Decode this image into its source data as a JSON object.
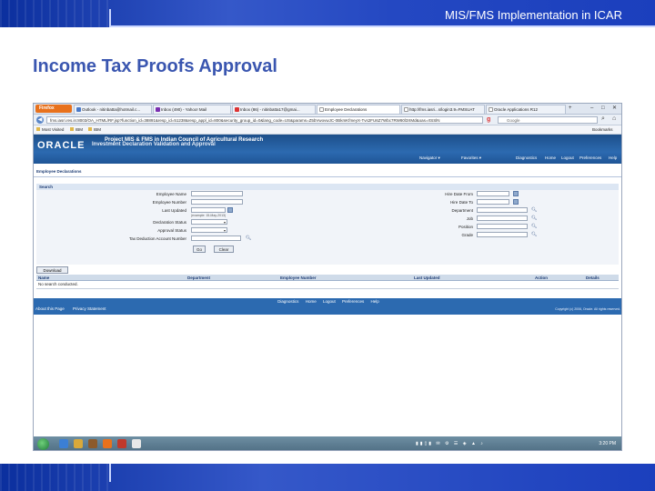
{
  "slide": {
    "header_title": "MIS/FMS Implementation in ICAR",
    "title": "Income Tax Proofs Approval"
  },
  "browser": {
    "menu_button": "Firefox",
    "tabs": [
      {
        "label": "Outlook - nitinbatta@hotmail.c..."
      },
      {
        "label": "Inbox (490) - Yahoo! Mail"
      },
      {
        "label": "Inbox (86) - nitinbatta17@gmai..."
      },
      {
        "label": "Employee Declarations"
      },
      {
        "label": "http://fms.iasri...s/login3.9=FMSUAT"
      },
      {
        "label": "Oracle Applications R12"
      }
    ],
    "url": "fms.iasri.res.in:8003/OA_HTML/RF.jsp?function_id=38891&resp_id=51238&resp_appl_id=800&security_group_id=0&lang_code=US&params=Z5bVwovwJC-0BkmKfmeyX-Tvs2FU6Z7Wbc7RW80l3XMd&oas=rtSSlN",
    "search_placeholder": "Google",
    "bookmarks": [
      "Most Visited",
      "IBM",
      "IBM"
    ],
    "bookmarks_right": "Bookmarks"
  },
  "app": {
    "logo": "ORACLE",
    "project_title": "Project MIS & FMS in Indian Council of Agricultural Research",
    "page_subtitle": "Investment Declaration Validation and Approval",
    "global_nav": {
      "navigator": "Navigator ▾",
      "favorites": "Favorites ▾",
      "diagnostics": "Diagnostics",
      "home": "Home",
      "logout": "Logout",
      "preferences": "Preferences",
      "help": "Help"
    },
    "page_heading": "Employee Declarations",
    "search_section": "Search",
    "fields_left": {
      "employee_name": "Employee Name",
      "employee_number": "Employee Number",
      "last_updated": "Last Updated",
      "last_updated_hint": "(example: 15-May-2013)",
      "declaration_status": "Declaration Status",
      "approval_status": "Approval Status",
      "tan": "Tax Deduction Account Number"
    },
    "fields_right": {
      "hire_from": "Hire Date From",
      "hire_to": "Hire Date To",
      "department": "Department",
      "job": "Job",
      "position": "Position",
      "grade": "Grade"
    },
    "buttons": {
      "go": "Go",
      "clear": "Clear",
      "download": "Download"
    },
    "results": {
      "columns": [
        "Name",
        "Department",
        "Employee Number",
        "Last Updated",
        "Action",
        "Details"
      ],
      "empty_message": "No search conducted."
    },
    "footer": {
      "links": [
        "Diagnostics",
        "Home",
        "Logout",
        "Preferences",
        "Help"
      ],
      "about": "About this Page",
      "privacy": "Privacy Statement",
      "copyright": "Copyright (c) 2006, Oracle. All rights reserved."
    }
  },
  "taskbar": {
    "clock": "3:20 PM"
  }
}
